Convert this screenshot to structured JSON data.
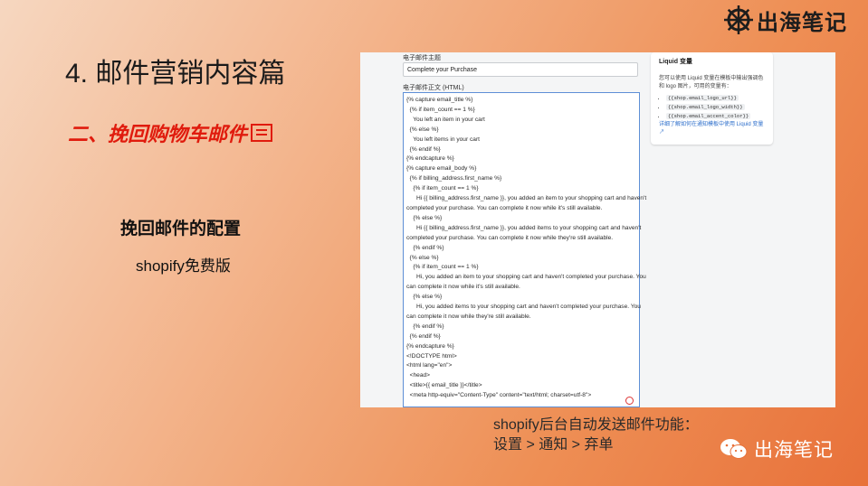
{
  "logo": {
    "text": "出海笔记"
  },
  "slide": {
    "title": "4. 邮件营销内容篇",
    "subtitle": "二、挽回购物车邮件",
    "config_heading": "挽回邮件的配置",
    "config_note": "shopify免费版"
  },
  "screenshot": {
    "subject_label": "电子邮件主题",
    "subject_value": "Complete your Purchase",
    "body_label": "电子邮件正文 (HTML)",
    "code_lines": [
      "{% capture email_title %}",
      "  {% if item_count == 1 %}",
      "    You left an item in your cart",
      "  {% else %}",
      "    You left items in your cart",
      "  {% endif %}",
      "{% endcapture %}",
      "{% capture email_body %}",
      "  {% if billing_address.first_name %}",
      "    {% if item_count == 1 %}",
      "      Hi {{ billing_address.first_name }}, you added an item to your shopping cart and haven't",
      "completed your purchase. You can complete it now while it's still available.",
      "    {% else %}",
      "      Hi {{ billing_address.first_name }}, you added items to your shopping cart and haven't",
      "completed your purchase. You can complete it now while they're still available.",
      "    {% endif %}",
      "  {% else %}",
      "    {% if item_count == 1 %}",
      "      Hi, you added an item to your shopping cart and haven't completed your purchase. You",
      "can complete it now while it's still available.",
      "    {% else %}",
      "      Hi, you added items to your shopping cart and haven't completed your purchase. You",
      "can complete it now while they're still available.",
      "    {% endif %}",
      "  {% endif %}",
      "{% endcapture %}",
      "",
      "<!DOCTYPE html>",
      "<html lang=\"en\">",
      "  <head>",
      "  <title>{{ email_title }}</title>",
      "  <meta http-equiv=\"Content-Type\" content=\"text/html; charset=utf-8\">"
    ],
    "side": {
      "title": "Liquid 变量",
      "desc": "您可以使用 Liquid 变量在模板中输出强调色和 logo 图片，可用的变量有：",
      "vars": [
        "{{shop.email_logo_url}}",
        "{{shop.email_logo_width}}",
        "{{shop.email_accent_color}}"
      ],
      "link": "详细了解如何在通知模板中使用 Liquid 变量"
    }
  },
  "caption": {
    "line1": "shopify后台自动发送邮件功能：",
    "line2": "设置 > 通知 > 弃单"
  },
  "wechat": {
    "text": "出海笔记"
  },
  "colors": {
    "accent_red": "#e01b0d",
    "editor_border": "#5e8fd6",
    "link_blue": "#2c6ecb"
  }
}
